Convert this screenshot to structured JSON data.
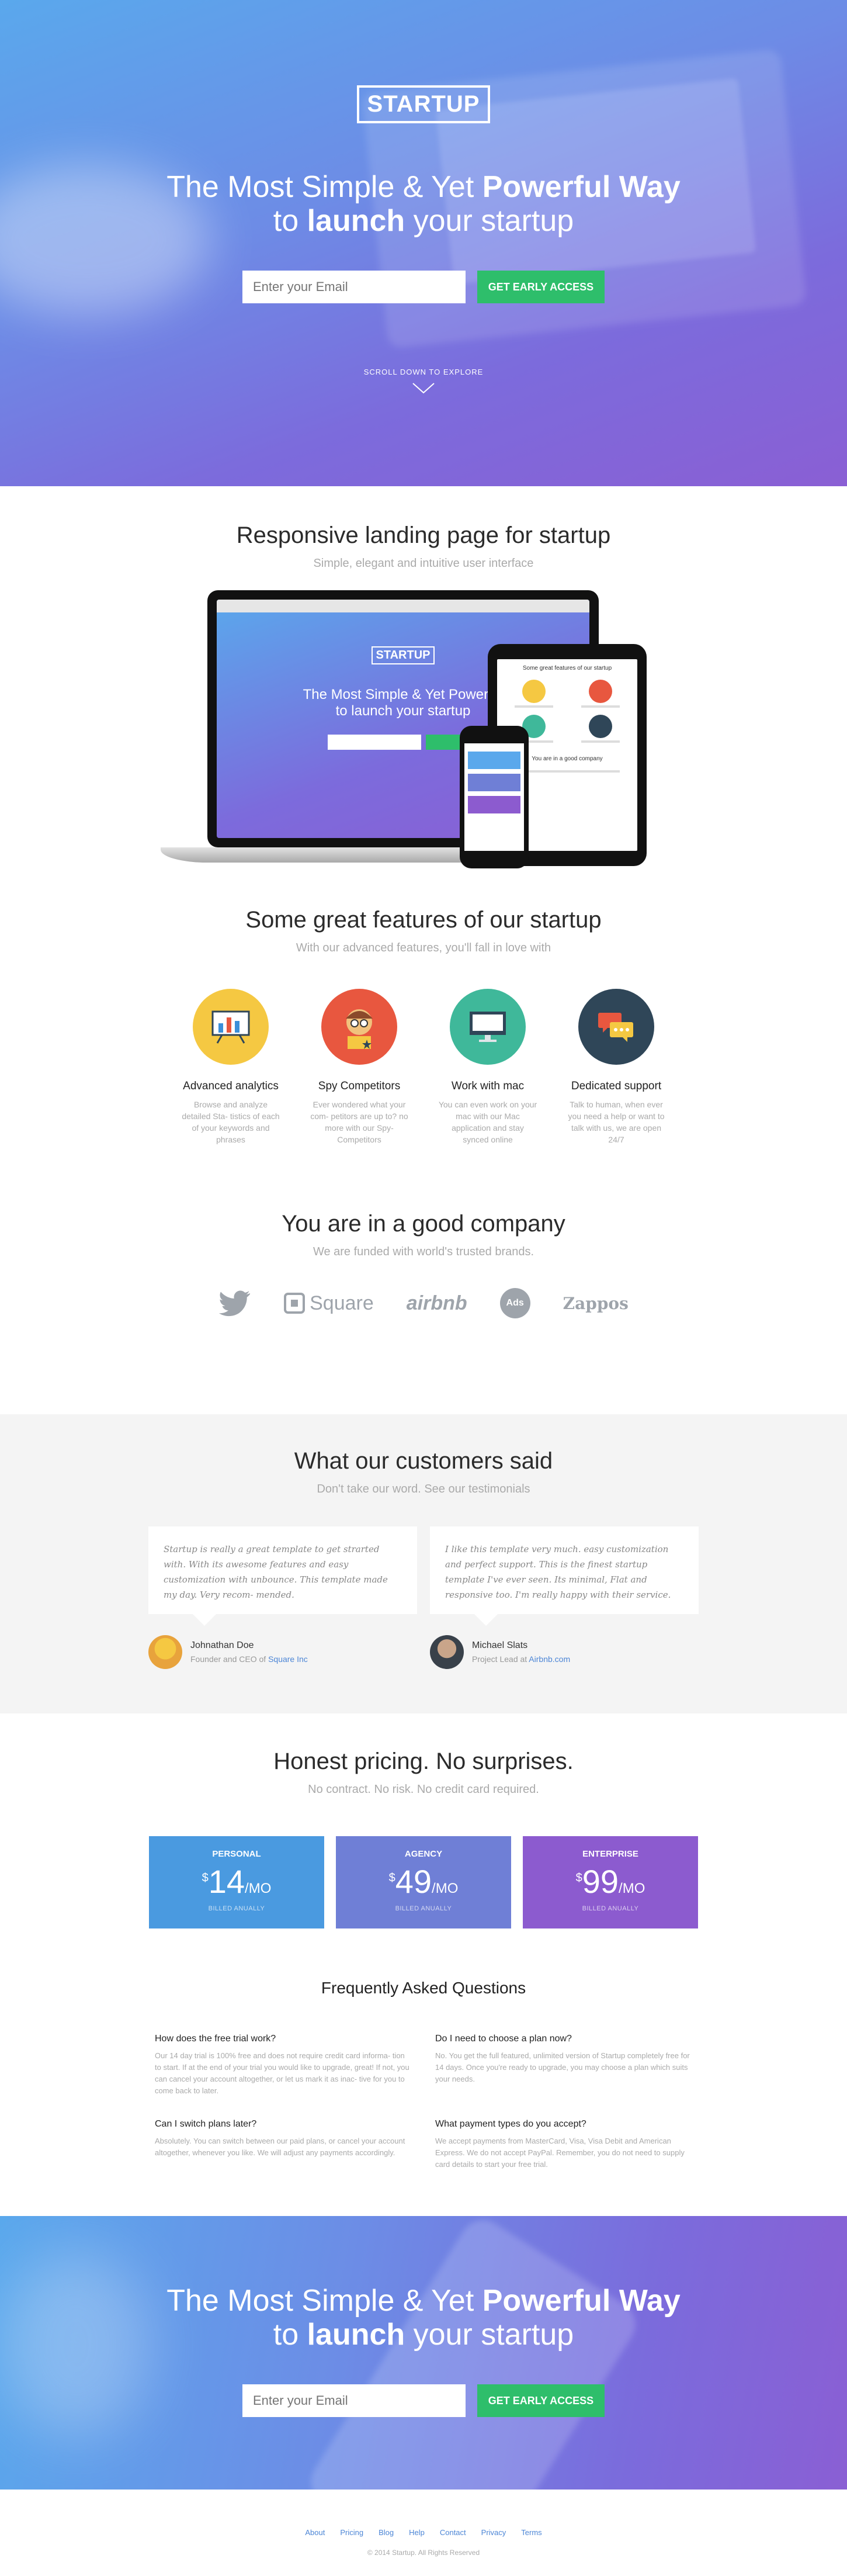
{
  "hero": {
    "logo": "STARTUP",
    "title_part1": "The Most Simple & Yet ",
    "title_bold1": "Powerful Way",
    "title_part2": "to ",
    "title_bold2": "launch",
    "title_part3": " your startup",
    "email_placeholder": "Enter your Email",
    "cta_label": "GET EARLY ACCESS",
    "scroll_hint": "SCROLL DOWN TO EXPLORE"
  },
  "devices": {
    "title": "Responsive landing page for startup",
    "subtitle": "Simple, elegant and intuitive user interface",
    "mockup_logo": "STARTUP",
    "mockup_title_part1": "The Most Simple & Yet ",
    "mockup_title_bold": "Powerful",
    "mockup_title_part2": "to ",
    "mockup_title_bold2": "launch",
    "mockup_title_part3": " your startup",
    "ipad_heading": "Some great features of our startup",
    "ipad_company": "You are in a good company"
  },
  "features": {
    "title": "Some great features of our startup",
    "subtitle": "With our advanced features, you'll fall in love with",
    "items": [
      {
        "title": "Advanced analytics",
        "text": "Browse and analyze detailed Sta- tistics of each of your keywords and phrases",
        "color": "#f5c842"
      },
      {
        "title": "Spy Competitors",
        "text": "Ever wondered what your com- petitors are up to? no more with our Spy-Competitors",
        "color": "#e8573f"
      },
      {
        "title": "Work with mac",
        "text": "You can even work on your mac with our Mac application and stay synced online",
        "color": "#3fb89a"
      },
      {
        "title": "Dedicated support",
        "text": "Talk to human, when ever you need a help or want to talk with us, we are open 24/7",
        "color": "#2f4658"
      }
    ]
  },
  "company": {
    "title": "You are in a good company",
    "subtitle": "We are funded with world's trusted brands.",
    "brands": [
      "Square",
      "airbnb",
      "Ads",
      "Zappos"
    ]
  },
  "testimonials": {
    "title": "What our customers said",
    "subtitle": "Don't take our word. See our testimonials",
    "items": [
      {
        "quote": "Startup is really a great template to get strarted with. With its awesome features and easy customization with unbounce. This template made my day. Very recom- mended.",
        "name": "Johnathan Doe",
        "role": "Founder and CEO of ",
        "company": "Square Inc"
      },
      {
        "quote": "I like this template very much. easy customization and perfect support. This is the finest startup template I've ever seen. Its minimal, Flat and responsive too. I'm really happy with their service.",
        "name": "Michael Slats",
        "role": "Project Lead at ",
        "company": "Airbnb.com"
      }
    ]
  },
  "pricing": {
    "title": "Honest pricing. No surprises.",
    "subtitle": "No contract. No risk. No credit card required.",
    "plans": [
      {
        "name": "PERSONAL",
        "currency": "$",
        "price": "14",
        "per": "/MO",
        "billed": "BILLED ANUALLY",
        "color": "#4a9ae0"
      },
      {
        "name": "AGENCY",
        "currency": "$",
        "price": "49",
        "per": "/MO",
        "billed": "BILLED ANUALLY",
        "color": "#6f7fd6"
      },
      {
        "name": "ENTERPRISE",
        "currency": "$",
        "price": "99",
        "per": "/MO",
        "billed": "BILLED ANUALLY",
        "color": "#8c5bcf"
      }
    ]
  },
  "faq": {
    "title": "Frequently Asked Questions",
    "items": [
      {
        "q": "How does the free trial work?",
        "a": "Our 14 day trial is 100% free and does not require credit card informa- tion to start. If at the end of your trial you would like to upgrade, great! If not, you can cancel your account altogether, or let us mark it as inac- tive for you to come back to later."
      },
      {
        "q": "Do I need to choose a plan now?",
        "a": "No. You get the full featured, unlimited version of Startup completely free for 14 days. Once you're ready to upgrade, you may choose a plan which suits your needs."
      },
      {
        "q": "Can I switch plans later?",
        "a": "Absolutely. You can switch between our paid plans, or cancel your account altogether, whenever you like. We will adjust any payments accordingly."
      },
      {
        "q": "What payment types do you accept?",
        "a": "We accept payments from MasterCard, Visa, Visa Debit and American Express. We do not accept PayPal. Remember, you do not need to supply card details to start your free trial."
      }
    ]
  },
  "cta": {
    "title_part1": "The Most Simple & Yet ",
    "title_bold1": "Powerful Way",
    "title_part2": "to ",
    "title_bold2": "launch",
    "title_part3": " your startup",
    "email_placeholder": "Enter your Email",
    "cta_label": "GET EARLY ACCESS"
  },
  "footer": {
    "links": [
      "About",
      "Pricing",
      "Blog",
      "Help",
      "Contact",
      "Privacy",
      "Terms"
    ],
    "copyright": "© 2014 Startup. All Rights Reserved"
  }
}
